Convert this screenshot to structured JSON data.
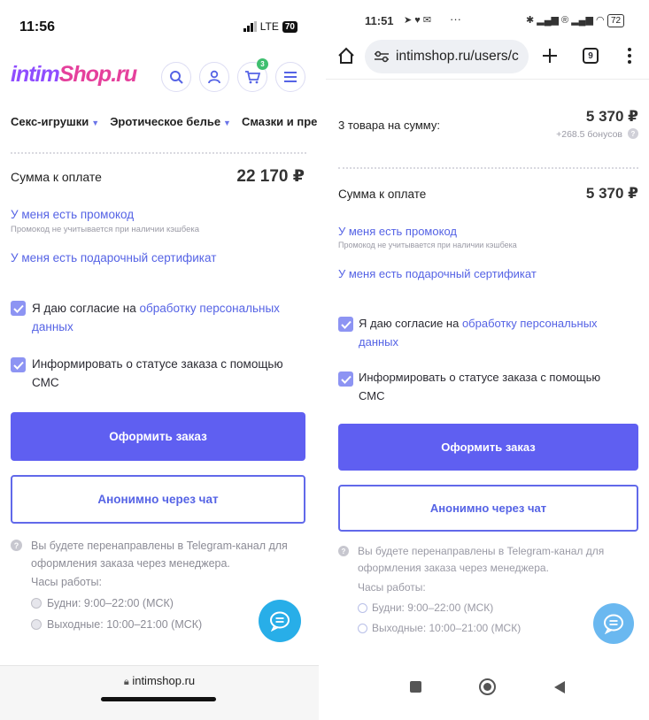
{
  "left": {
    "status": {
      "time": "11:56",
      "network": "LTE",
      "battery": "70"
    },
    "header": {
      "logo_part1": "intim",
      "logo_part2": "Shop",
      "logo_part3": ".ru",
      "cart_count": "3"
    },
    "nav": [
      {
        "label": "Секс-игрушки"
      },
      {
        "label": "Эротическое белье"
      },
      {
        "label": "Смазки и пре"
      }
    ],
    "summary": {
      "label": "Сумма к оплате",
      "value": "22 170 ₽"
    },
    "promo": {
      "link": "У меня есть промокод",
      "note": "Промокод не учитывается при наличии кэшбека"
    },
    "gift": "У меня есть подарочный сертификат",
    "consent": {
      "prefix": "Я даю согласие на ",
      "link": "обработку персональных данных"
    },
    "sms": "Информировать о статусе заказа с помощью СМС",
    "order_button": "Оформить заказ",
    "chat_button": "Анонимно через чат",
    "telegram_note": "Вы будете перенаправлены в Telegram-канал для оформления заказа через менеджера.",
    "hours_label": "Часы работы:",
    "weekdays": "Будни: 9:00–22:00 (МСК)",
    "weekends": "Выходные: 10:00–21:00 (МСК)",
    "bottom_url": "intimshop.ru"
  },
  "right": {
    "status": {
      "time": "11:51",
      "more": "···",
      "battery": "72"
    },
    "browser": {
      "url": "intimshop.ru/users/c",
      "tab_count": "9"
    },
    "items": {
      "label": "3 товара на сумму:",
      "value": "5 370 ₽",
      "bonus": "+268.5 бонусов"
    },
    "summary": {
      "label": "Сумма к оплате",
      "value": "5 370 ₽"
    },
    "promo": {
      "link": "У меня есть промокод",
      "note": "Промокод не учитывается при наличии кэшбека"
    },
    "gift": "У меня есть подарочный сертификат",
    "consent": {
      "prefix": "Я даю согласие на ",
      "link": "обработку персональных данных"
    },
    "sms": "Информировать о статусе заказа с помощью СМС",
    "order_button": "Оформить заказ",
    "chat_button": "Анонимно через чат",
    "telegram_note": "Вы будете перенаправлены в Telegram-канал для оформления заказа через менеджера.",
    "hours_label": "Часы работы:",
    "weekdays": "Будни: 9:00–22:00 (МСК)",
    "weekends": "Выходные: 10:00–21:00 (МСК)"
  },
  "colors": {
    "accent": "#5f5ff1",
    "link": "#5563e5",
    "checkbox": "#8d94f3",
    "chat_fab": "#28aee8",
    "cart_badge": "#3fbf6f"
  }
}
